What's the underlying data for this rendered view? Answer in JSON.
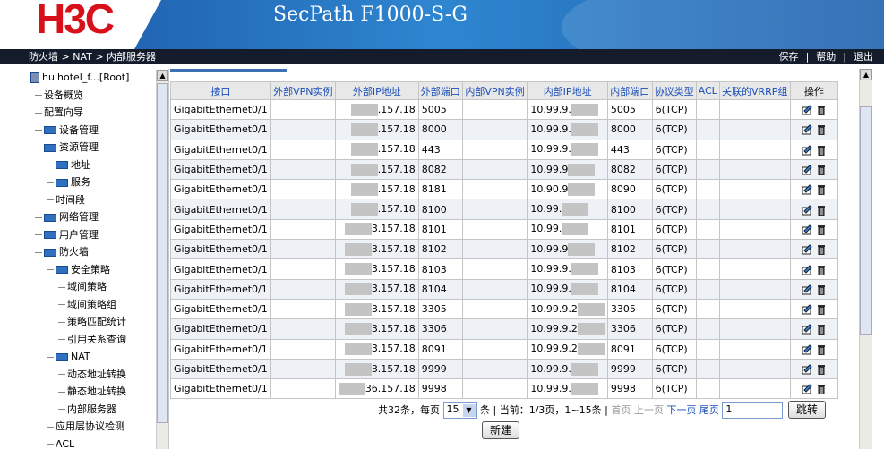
{
  "header": {
    "logo": "H3C",
    "product": "SecPath F1000-S-G"
  },
  "topbar": {
    "breadcrumb": "防火墙 > NAT > 内部服务器",
    "links": [
      "保存",
      "|",
      "帮助",
      "|",
      "退出"
    ]
  },
  "sidebar": {
    "items": [
      {
        "label": "huihotel_f...[Root]",
        "level": 0,
        "icon": "device-icon"
      },
      {
        "label": "设备概览",
        "level": 1
      },
      {
        "label": "配置向导",
        "level": 1
      },
      {
        "label": "设备管理",
        "level": 1,
        "icon": "folder-icon"
      },
      {
        "label": "资源管理",
        "level": 1,
        "icon": "folder-icon"
      },
      {
        "label": "地址",
        "level": 2,
        "icon": "folder-icon"
      },
      {
        "label": "服务",
        "level": 2,
        "icon": "folder-icon"
      },
      {
        "label": "时间段",
        "level": 2
      },
      {
        "label": "网络管理",
        "level": 1,
        "icon": "folder-icon"
      },
      {
        "label": "用户管理",
        "level": 1,
        "icon": "folder-icon"
      },
      {
        "label": "防火墙",
        "level": 1,
        "icon": "folder-icon"
      },
      {
        "label": "安全策略",
        "level": 2,
        "icon": "folder-icon"
      },
      {
        "label": "域间策略",
        "level": 3
      },
      {
        "label": "域间策略组",
        "level": 3
      },
      {
        "label": "策略匹配统计",
        "level": 3
      },
      {
        "label": "引用关系查询",
        "level": 3
      },
      {
        "label": "NAT",
        "level": 2,
        "icon": "folder-icon"
      },
      {
        "label": "动态地址转换",
        "level": 3
      },
      {
        "label": "静态地址转换",
        "level": 3
      },
      {
        "label": "内部服务器",
        "level": 3
      },
      {
        "label": "应用层协议检测",
        "level": 2
      },
      {
        "label": "ACL",
        "level": 2
      }
    ]
  },
  "table": {
    "headers": [
      "接口",
      "外部VPN实例",
      "外部IP地址",
      "外部端口",
      "内部VPN实例",
      "内部IP地址",
      "内部端口",
      "协议类型",
      "ACL",
      "关联的VRRP组",
      "操作"
    ],
    "rows": [
      [
        "GigabitEthernet0/1",
        "",
        ".157.18",
        "5005",
        "",
        "10.99.9.",
        "5005",
        "6(TCP)",
        "",
        ""
      ],
      [
        "GigabitEthernet0/1",
        "",
        ".157.18",
        "8000",
        "",
        "10.99.9.",
        "8000",
        "6(TCP)",
        "",
        ""
      ],
      [
        "GigabitEthernet0/1",
        "",
        ".157.18",
        "443",
        "",
        "10.99.9.",
        "443",
        "6(TCP)",
        "",
        ""
      ],
      [
        "GigabitEthernet0/1",
        "",
        ".157.18",
        "8082",
        "",
        "10.99.9",
        "8082",
        "6(TCP)",
        "",
        ""
      ],
      [
        "GigabitEthernet0/1",
        "",
        ".157.18",
        "8181",
        "",
        "10.90.9",
        "8090",
        "6(TCP)",
        "",
        ""
      ],
      [
        "GigabitEthernet0/1",
        "",
        ".157.18",
        "8100",
        "",
        "10.99.",
        "8100",
        "6(TCP)",
        "",
        ""
      ],
      [
        "GigabitEthernet0/1",
        "",
        "3.157.18",
        "8101",
        "",
        "10.99.",
        "8101",
        "6(TCP)",
        "",
        ""
      ],
      [
        "GigabitEthernet0/1",
        "",
        "3.157.18",
        "8102",
        "",
        "10.99.9",
        "8102",
        "6(TCP)",
        "",
        ""
      ],
      [
        "GigabitEthernet0/1",
        "",
        "3.157.18",
        "8103",
        "",
        "10.99.9.",
        "8103",
        "6(TCP)",
        "",
        ""
      ],
      [
        "GigabitEthernet0/1",
        "",
        "3.157.18",
        "8104",
        "",
        "10.99.9.",
        "8104",
        "6(TCP)",
        "",
        ""
      ],
      [
        "GigabitEthernet0/1",
        "",
        "3.157.18",
        "3305",
        "",
        "10.99.9.2",
        "3305",
        "6(TCP)",
        "",
        ""
      ],
      [
        "GigabitEthernet0/1",
        "",
        "3.157.18",
        "3306",
        "",
        "10.99.9.2",
        "3306",
        "6(TCP)",
        "",
        ""
      ],
      [
        "GigabitEthernet0/1",
        "",
        "3.157.18",
        "8091",
        "",
        "10.99.9.2",
        "8091",
        "6(TCP)",
        "",
        ""
      ],
      [
        "GigabitEthernet0/1",
        "",
        "3.157.18",
        "9999",
        "",
        "10.99.9.",
        "9999",
        "6(TCP)",
        "",
        ""
      ],
      [
        "GigabitEthernet0/1",
        "",
        "36.157.18",
        "9998",
        "",
        "10.99.9.",
        "9998",
        "6(TCP)",
        "",
        ""
      ]
    ]
  },
  "pagination": {
    "total": "共32条，每页",
    "per_page": "15",
    "suffix": "条 | 当前：1/3页，1~15条 |",
    "first": "首页",
    "prev": "上一页",
    "next": "下一页",
    "last": "尾页",
    "page_input": "1",
    "go": "跳转"
  },
  "new_button": "新建"
}
